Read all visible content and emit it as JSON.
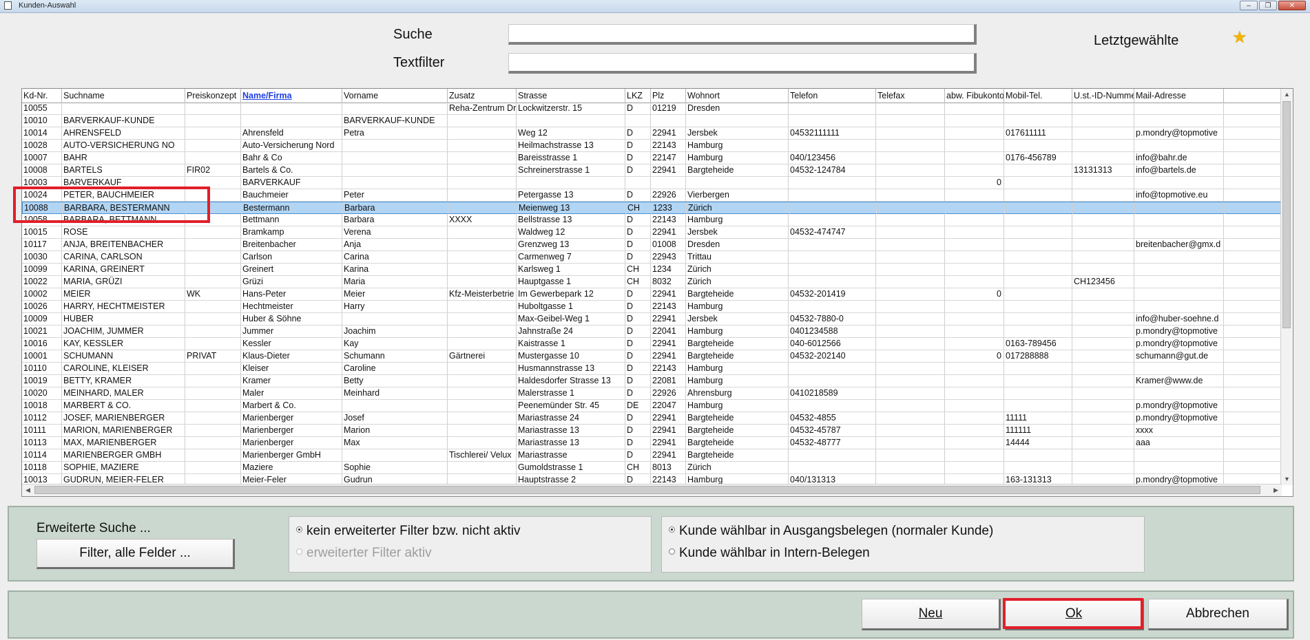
{
  "window": {
    "title": "Kunden-Auswahl",
    "minimize": "–",
    "maximize": "❐",
    "close": "✕"
  },
  "search": {
    "suche_label": "Suche",
    "suche_value": "",
    "textfilter_label": "Textfilter",
    "textfilter_value": ""
  },
  "recent": {
    "label": "Letztgewählte",
    "icon": "star-icon",
    "icon_color": "#f5b400"
  },
  "table": {
    "columns": [
      "Kd-Nr.",
      "Suchname",
      "Preiskonzept",
      "Name/Firma",
      "Vorname",
      "Zusatz",
      "Strasse",
      "LKZ",
      "Plz",
      "Wohnort",
      "Telefon",
      "Telefax",
      "abw. Fibukonto",
      "Mobil-Tel.",
      "U.st.-ID-Nummer",
      "Mail-Adresse"
    ],
    "sorted_column": "Name/Firma",
    "selected_row": 8,
    "rows": [
      [
        "10055",
        "",
        "",
        "",
        "",
        "Reha-Zentrum Dr",
        "Lockwitzerstr. 15",
        "D",
        "01219",
        "Dresden",
        "",
        "",
        "",
        "",
        "",
        ""
      ],
      [
        "10010",
        "BARVERKAUF-KUNDE",
        "",
        "",
        "BARVERKAUF-KUNDE",
        "",
        "",
        "",
        "",
        "",
        "",
        "",
        "",
        "",
        "",
        ""
      ],
      [
        "10014",
        "AHRENSFELD",
        "",
        "Ahrensfeld",
        "Petra",
        "",
        "Weg 12",
        "D",
        "22941",
        "Jersbek",
        "04532111111",
        "",
        "",
        "017611111",
        "",
        "p.mondry@topmotive"
      ],
      [
        "10028",
        "AUTO-VERSICHERUNG NO",
        "",
        "Auto-Versicherung Nord",
        "",
        "",
        "Heilmachstrasse 13",
        "D",
        "22143",
        "Hamburg",
        "",
        "",
        "",
        "",
        "",
        ""
      ],
      [
        "10007",
        "BAHR",
        "",
        "Bahr & Co",
        "",
        "",
        "Bareisstrasse 1",
        "D",
        "22147",
        "Hamburg",
        "040/123456",
        "",
        "",
        "0176-456789",
        "",
        "info@bahr.de"
      ],
      [
        "10008",
        "BARTELS",
        "FIR02",
        "Bartels & Co.",
        "",
        "",
        "Schreinerstrasse 1",
        "D",
        "22941",
        "Bargteheide",
        "04532-124784",
        "",
        "",
        "",
        "13131313",
        "info@bartels.de"
      ],
      [
        "10003",
        "BARVERKAUF",
        "",
        "BARVERKAUF",
        "",
        "",
        "",
        "",
        "",
        "",
        "",
        "",
        "0",
        "",
        "",
        ""
      ],
      [
        "10024",
        "PETER, BAUCHMEIER",
        "",
        "Bauchmeier",
        "Peter",
        "",
        "Petergasse 13",
        "D",
        "22926",
        "Vierbergen",
        "",
        "",
        "",
        "",
        "",
        "info@topmotive.eu"
      ],
      [
        "10088",
        "BARBARA, BESTERMANN",
        "",
        "Bestermann",
        "Barbara",
        "",
        "Meienweg 13",
        "CH",
        "1233",
        "Zürich",
        "",
        "",
        "",
        "",
        "",
        ""
      ],
      [
        "10058",
        "BARBARA, BETTMANN",
        "",
        "Bettmann",
        "Barbara",
        "XXXX",
        "Bellstrasse 13",
        "D",
        "22143",
        "Hamburg",
        "",
        "",
        "",
        "",
        "",
        ""
      ],
      [
        "10015",
        "ROSE",
        "",
        "Bramkamp",
        "Verena",
        "",
        "Waldweg 12",
        "D",
        "22941",
        "Jersbek",
        "04532-474747",
        "",
        "",
        "",
        "",
        ""
      ],
      [
        "10117",
        "ANJA, BREITENBACHER",
        "",
        "Breitenbacher",
        "Anja",
        "",
        "Grenzweg 13",
        "D",
        "01008",
        "Dresden",
        "",
        "",
        "",
        "",
        "",
        "breitenbacher@gmx.d"
      ],
      [
        "10030",
        "CARINA, CARLSON",
        "",
        "Carlson",
        "Carina",
        "",
        "Carmenweg 7",
        "D",
        "22943",
        "Trittau",
        "",
        "",
        "",
        "",
        "",
        ""
      ],
      [
        "10099",
        "KARINA, GREINERT",
        "",
        "Greinert",
        "Karina",
        "",
        "Karlsweg 1",
        "CH",
        "1234",
        "Zürich",
        "",
        "",
        "",
        "",
        "",
        ""
      ],
      [
        "10022",
        "MARIA, GRÜZI",
        "",
        "Grüzi",
        "Maria",
        "",
        "Hauptgasse 1",
        "CH",
        "8032",
        "Zürich",
        "",
        "",
        "",
        "",
        "CH123456",
        ""
      ],
      [
        "10002",
        "MEIER",
        "WK",
        "Hans-Peter",
        "Meier",
        "Kfz-Meisterbetrie",
        "Im Gewerbepark 12",
        "D",
        "22941",
        "Bargteheide",
        "04532-201419",
        "",
        "0",
        "",
        "",
        ""
      ],
      [
        "10026",
        "HARRY, HECHTMEISTER",
        "",
        "Hechtmeister",
        "Harry",
        "",
        "Huboltgasse 1",
        "D",
        "22143",
        "Hamburg",
        "",
        "",
        "",
        "",
        "",
        ""
      ],
      [
        "10009",
        "HUBER",
        "",
        "Huber & Söhne",
        "",
        "",
        "Max-Geibel-Weg 1",
        "D",
        "22941",
        "Jersbek",
        "04532-7880-0",
        "",
        "",
        "",
        "",
        "info@huber-soehne.d"
      ],
      [
        "10021",
        "JOACHIM, JUMMER",
        "",
        "Jummer",
        "Joachim",
        "",
        "Jahnstraße 24",
        "D",
        "22041",
        "Hamburg",
        "0401234588",
        "",
        "",
        "",
        "",
        "p.mondry@topmotive"
      ],
      [
        "10016",
        "KAY, KESSLER",
        "",
        "Kessler",
        "Kay",
        "",
        "Kaistrasse 1",
        "D",
        "22941",
        "Bargteheide",
        "040-6012566",
        "",
        "",
        "0163-789456",
        "",
        "p.mondry@topmotive"
      ],
      [
        "10001",
        "SCHUMANN",
        "PRIVAT",
        "Klaus-Dieter",
        "Schumann",
        "Gärtnerei",
        "Mustergasse 10",
        "D",
        "22941",
        "Bargteheide",
        "04532-202140",
        "",
        "0",
        "017288888",
        "",
        "schumann@gut.de"
      ],
      [
        "10110",
        "CAROLINE, KLEISER",
        "",
        "Kleiser",
        "Caroline",
        "",
        "Husmannstrasse 13",
        "D",
        "22143",
        "Hamburg",
        "",
        "",
        "",
        "",
        "",
        ""
      ],
      [
        "10019",
        "BETTY, KRAMER",
        "",
        "Kramer",
        "Betty",
        "",
        "Haldesdorfer Strasse 13",
        "D",
        "22081",
        "Hamburg",
        "",
        "",
        "",
        "",
        "",
        "Kramer@www.de"
      ],
      [
        "10020",
        "MEINHARD, MALER",
        "",
        "Maler",
        "Meinhard",
        "",
        "Malerstrasse 1",
        "D",
        "22926",
        "Ahrensburg",
        "0410218589",
        "",
        "",
        "",
        "",
        ""
      ],
      [
        "10018",
        "MARBERT & CO.",
        "",
        "Marbert & Co.",
        "",
        "",
        "Peenemünder Str. 45",
        "DE",
        "22047",
        "Hamburg",
        "",
        "",
        "",
        "",
        "",
        "p.mondry@topmotive"
      ],
      [
        "10112",
        "JOSEF, MARIENBERGER",
        "",
        "Marienberger",
        "Josef",
        "",
        "Mariastrasse 24",
        "D",
        "22941",
        "Bargteheide",
        "04532-4855",
        "",
        "",
        "11111",
        "",
        "p.mondry@topmotive"
      ],
      [
        "10111",
        "MARION, MARIENBERGER",
        "",
        "Marienberger",
        "Marion",
        "",
        "Mariastrasse 13",
        "D",
        "22941",
        "Bargteheide",
        "04532-45787",
        "",
        "",
        "111111",
        "",
        "xxxx"
      ],
      [
        "10113",
        "MAX, MARIENBERGER",
        "",
        "Marienberger",
        "Max",
        "",
        "Mariastrasse 13",
        "D",
        "22941",
        "Bargteheide",
        "04532-48777",
        "",
        "",
        "14444",
        "",
        "aaa"
      ],
      [
        "10114",
        "MARIENBERGER GMBH",
        "",
        "Marienberger GmbH",
        "",
        "Tischlerei/ Velux",
        "Mariastrasse",
        "D",
        "22941",
        "Bargteheide",
        "",
        "",
        "",
        "",
        "",
        ""
      ],
      [
        "10118",
        "SOPHIE, MAZIERE",
        "",
        "Maziere",
        "Sophie",
        "",
        "Gumoldstrasse 1",
        "CH",
        "8013",
        "Zürich",
        "",
        "",
        "",
        "",
        "",
        ""
      ],
      [
        "10013",
        "GUDRUN, MEIER-FELER",
        "",
        "Meier-Feler",
        "Gudrun",
        "",
        "Hauptstrasse 2",
        "D",
        "22143",
        "Hamburg",
        "040/131313",
        "",
        "",
        "163-131313",
        "",
        "p.mondry@topmotive"
      ]
    ]
  },
  "extended_search": {
    "title": "Erweiterte Suche ...",
    "filter_button": "Filter, alle Felder ...",
    "filter_options": [
      {
        "label": "kein erweiterter Filter bzw. nicht aktiv",
        "checked": true,
        "disabled": false
      },
      {
        "label": "erweiterter Filter aktiv",
        "checked": false,
        "disabled": true
      }
    ],
    "customer_options": [
      {
        "label": "Kunde wählbar in Ausgangsbelegen (normaler Kunde)",
        "checked": true,
        "disabled": false
      },
      {
        "label": "Kunde wählbar in Intern-Belegen",
        "checked": false,
        "disabled": false
      }
    ]
  },
  "buttons": {
    "neu": "Neu",
    "ok": "Ok",
    "abbrechen": "Abbrechen",
    "highlight_color": "#e11f2a"
  }
}
